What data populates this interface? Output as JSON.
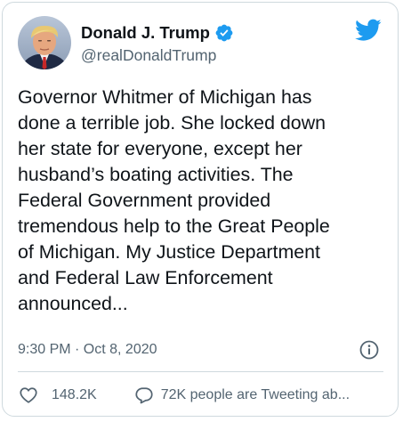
{
  "author": {
    "name": "Donald J. Trump",
    "handle": "@realDonaldTrump",
    "verified": true
  },
  "tweet": {
    "lines": [
      "Governor Whitmer of Michigan has",
      "done a terrible job. She locked down",
      "her state for everyone, except her",
      "husband’s boating activities. The",
      "Federal Government provided",
      "tremendous help to the Great People",
      "of Michigan. My Justice Department",
      "and Federal Law Enforcement",
      "announced..."
    ],
    "timestamp": "9:30 PM · Oct 8, 2020"
  },
  "actions": {
    "like_count": "148.2K",
    "replies_text": "72K people are Tweeting ab..."
  },
  "icons": {
    "brand": "twitter-bird-icon",
    "verified": "verified-badge-icon",
    "info": "info-icon",
    "like": "heart-icon",
    "reply": "reply-icon"
  },
  "colors": {
    "brand_blue": "#1d9bf0",
    "text": "#0f1419",
    "secondary": "#536471",
    "border": "#cfd9de"
  }
}
